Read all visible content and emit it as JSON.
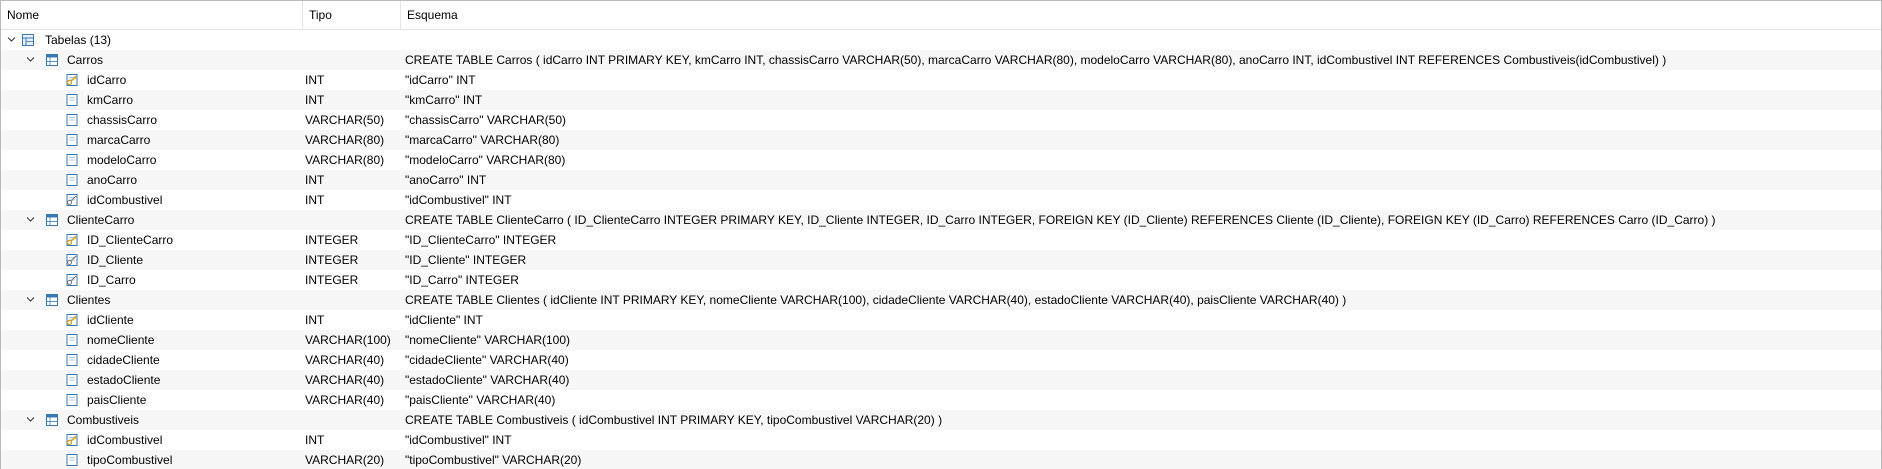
{
  "columns": {
    "name": "Nome",
    "type": "Tipo",
    "schema": "Esquema"
  },
  "root": {
    "label": "Tabelas (13)"
  },
  "tables": [
    {
      "name": "Carros",
      "schema": "CREATE TABLE Carros ( idCarro INT PRIMARY KEY, kmCarro INT, chassisCarro VARCHAR(50), marcaCarro VARCHAR(80), modeloCarro VARCHAR(80), anoCarro INT, idCombustivel INT REFERENCES Combustiveis(idCombustivel) )",
      "columns": [
        {
          "name": "idCarro",
          "type": "INT",
          "schema": "\"idCarro\" INT",
          "key": "primary"
        },
        {
          "name": "kmCarro",
          "type": "INT",
          "schema": "\"kmCarro\" INT",
          "key": "none"
        },
        {
          "name": "chassisCarro",
          "type": "VARCHAR(50)",
          "schema": "\"chassisCarro\" VARCHAR(50)",
          "key": "none"
        },
        {
          "name": "marcaCarro",
          "type": "VARCHAR(80)",
          "schema": "\"marcaCarro\" VARCHAR(80)",
          "key": "none"
        },
        {
          "name": "modeloCarro",
          "type": "VARCHAR(80)",
          "schema": "\"modeloCarro\" VARCHAR(80)",
          "key": "none"
        },
        {
          "name": "anoCarro",
          "type": "INT",
          "schema": "\"anoCarro\" INT",
          "key": "none"
        },
        {
          "name": "idCombustivel",
          "type": "INT",
          "schema": "\"idCombustivel\" INT",
          "key": "foreign"
        }
      ]
    },
    {
      "name": "ClienteCarro",
      "schema": "CREATE TABLE ClienteCarro ( ID_ClienteCarro INTEGER PRIMARY KEY, ID_Cliente INTEGER, ID_Carro INTEGER, FOREIGN KEY (ID_Cliente) REFERENCES Cliente (ID_Cliente), FOREIGN KEY (ID_Carro) REFERENCES Carro (ID_Carro) )",
      "columns": [
        {
          "name": "ID_ClienteCarro",
          "type": "INTEGER",
          "schema": "\"ID_ClienteCarro\" INTEGER",
          "key": "primary"
        },
        {
          "name": "ID_Cliente",
          "type": "INTEGER",
          "schema": "\"ID_Cliente\" INTEGER",
          "key": "foreign"
        },
        {
          "name": "ID_Carro",
          "type": "INTEGER",
          "schema": "\"ID_Carro\" INTEGER",
          "key": "foreign"
        }
      ]
    },
    {
      "name": "Clientes",
      "schema": "CREATE TABLE Clientes ( idCliente INT PRIMARY KEY, nomeCliente VARCHAR(100), cidadeCliente VARCHAR(40), estadoCliente VARCHAR(40), paisCliente VARCHAR(40) )",
      "columns": [
        {
          "name": "idCliente",
          "type": "INT",
          "schema": "\"idCliente\" INT",
          "key": "primary"
        },
        {
          "name": "nomeCliente",
          "type": "VARCHAR(100)",
          "schema": "\"nomeCliente\" VARCHAR(100)",
          "key": "none"
        },
        {
          "name": "cidadeCliente",
          "type": "VARCHAR(40)",
          "schema": "\"cidadeCliente\" VARCHAR(40)",
          "key": "none"
        },
        {
          "name": "estadoCliente",
          "type": "VARCHAR(40)",
          "schema": "\"estadoCliente\" VARCHAR(40)",
          "key": "none"
        },
        {
          "name": "paisCliente",
          "type": "VARCHAR(40)",
          "schema": "\"paisCliente\" VARCHAR(40)",
          "key": "none"
        }
      ]
    },
    {
      "name": "Combustiveis",
      "schema": "CREATE TABLE Combustiveis ( idCombustivel INT PRIMARY KEY, tipoCombustivel VARCHAR(20) )",
      "columns": [
        {
          "name": "idCombustivel",
          "type": "INT",
          "schema": "\"idCombustivel\" INT",
          "key": "primary"
        },
        {
          "name": "tipoCombustivel",
          "type": "VARCHAR(20)",
          "schema": "\"tipoCombustivel\" VARCHAR(20)",
          "key": "none"
        }
      ]
    }
  ],
  "colors": {
    "row_alt": "#f7f7f7",
    "icon_blue": "#3c78b4",
    "icon_fill": "#e6f0fa",
    "key_gold": "#d6a21a",
    "fk_gray": "#7a7a7a",
    "chevron": "#444444"
  }
}
